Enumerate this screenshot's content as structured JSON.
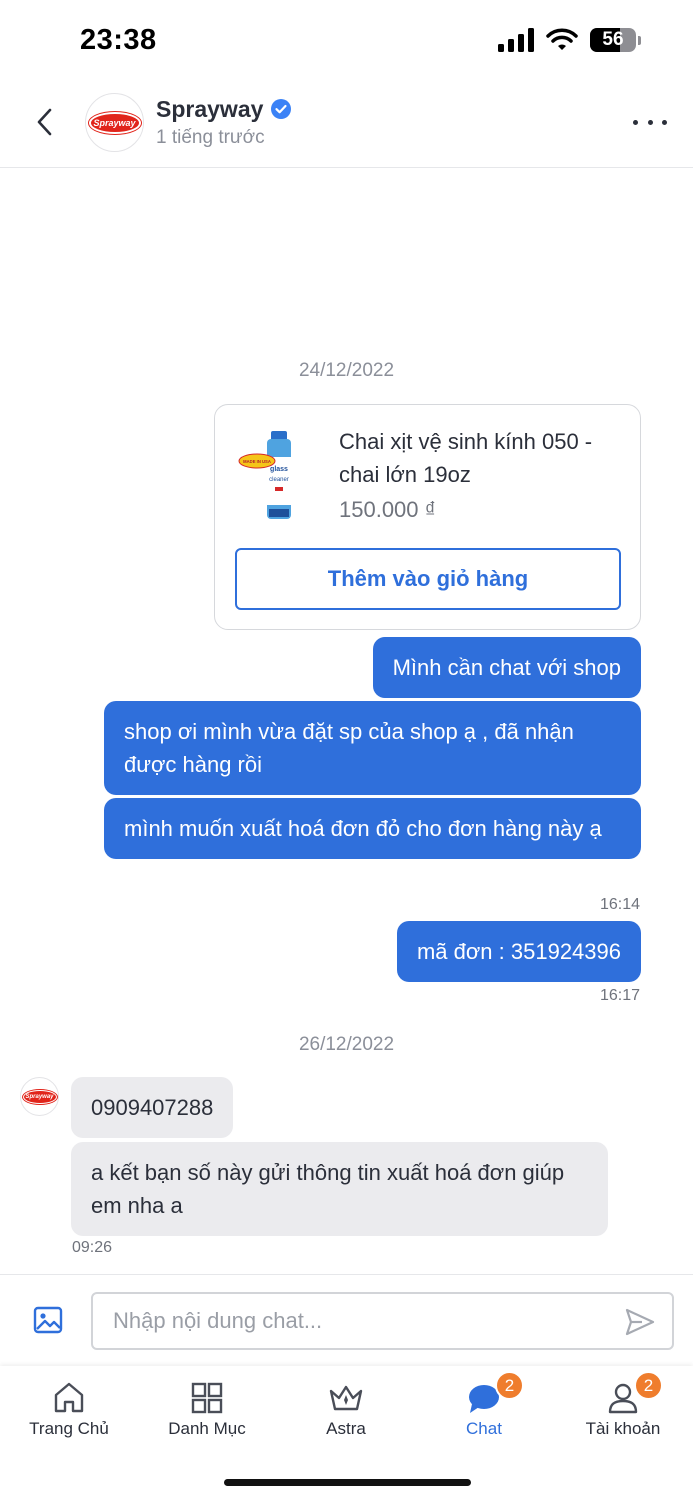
{
  "status_bar": {
    "time": "23:38",
    "battery": "56"
  },
  "header": {
    "shop_name": "Sprayway",
    "shop_status": "1 tiếng trước",
    "logo_text": "Sprayway"
  },
  "messages": {
    "date_1": "24/12/2022",
    "product": {
      "name": "Chai xịt vệ sinh kính 050 - chai lớn 19oz",
      "price": "150.000 ₫",
      "add_to_cart": "Thêm vào giỏ hàng",
      "image_labels": {
        "badge": "MADE IN USA",
        "line1": "glass",
        "line2": "cleaner"
      }
    },
    "outgoing": [
      "Mình cần chat với shop",
      "shop ơi mình vừa đặt sp của shop ạ , đã nhận được hàng rồi",
      "mình muốn xuất hoá đơn đỏ cho đơn hàng này ạ",
      "mã đơn : 351924396"
    ],
    "time_1": "16:14",
    "time_2": "16:17",
    "date_2": "26/12/2022",
    "incoming": [
      "0909407288",
      "a kết bạn số này gửi thông tin xuất hoá đơn giúp em nha a"
    ],
    "time_3": "09:26"
  },
  "composer": {
    "placeholder": "Nhập nội dung chat..."
  },
  "nav": {
    "items": [
      {
        "label": "Trang Chủ",
        "icon": "home-icon"
      },
      {
        "label": "Danh Mục",
        "icon": "grid-icon"
      },
      {
        "label": "Astra",
        "icon": "crown-icon"
      },
      {
        "label": "Chat",
        "icon": "chat-icon",
        "badge": "2",
        "active": true
      },
      {
        "label": "Tài khoản",
        "icon": "user-icon",
        "badge": "2"
      }
    ]
  },
  "colors": {
    "primary": "#2f6fdb",
    "badge": "#ef7d2d",
    "brand_red": "#e1251b"
  }
}
